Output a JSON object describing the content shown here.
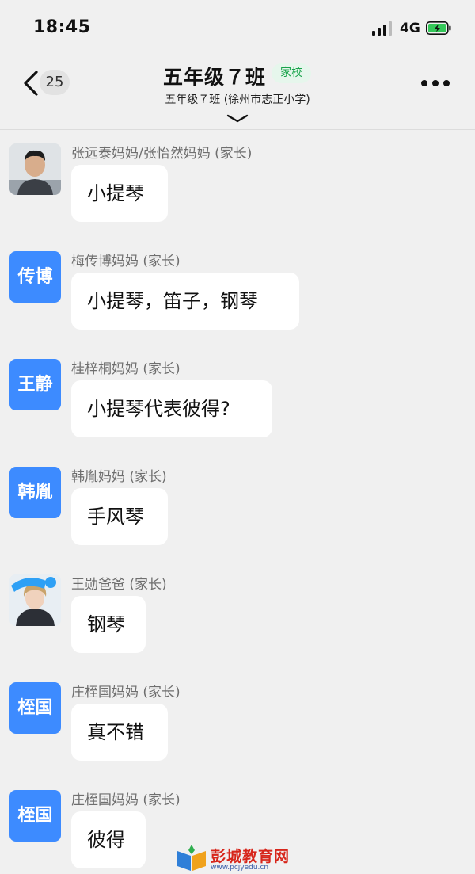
{
  "status_bar": {
    "time": "18:45",
    "network": "4G"
  },
  "header": {
    "back_count": "25",
    "title": "五年级７班",
    "tag": "家校",
    "subtitle": "五年级７班 (徐州市志正小学)"
  },
  "messages": [
    {
      "sender": "张远泰妈妈/张怡然妈妈 (家长)",
      "avatar_text": "",
      "text": "小提琴"
    },
    {
      "sender": "梅传博妈妈 (家长)",
      "avatar_text": "传博",
      "text": "小提琴，笛子，钢琴"
    },
    {
      "sender": "桂梓桐妈妈 (家长)",
      "avatar_text": "王静",
      "text": "小提琴代表彼得?"
    },
    {
      "sender": "韩胤妈妈 (家长)",
      "avatar_text": "韩胤",
      "text": "手风琴"
    },
    {
      "sender": "王勋爸爸 (家长)",
      "avatar_text": "",
      "text": "钢琴"
    },
    {
      "sender": "庄桎国妈妈 (家长)",
      "avatar_text": "桎国",
      "text": "真不错"
    },
    {
      "sender": "庄桎国妈妈 (家长)",
      "avatar_text": "桎国",
      "text": "彼得"
    }
  ],
  "watermark": {
    "name": "彭城教育网",
    "url": "www.pcjyedu.cn"
  },
  "colors": {
    "accent": "#3d8bff",
    "tag_green": "#18a34a",
    "background": "#f0f0f0"
  }
}
